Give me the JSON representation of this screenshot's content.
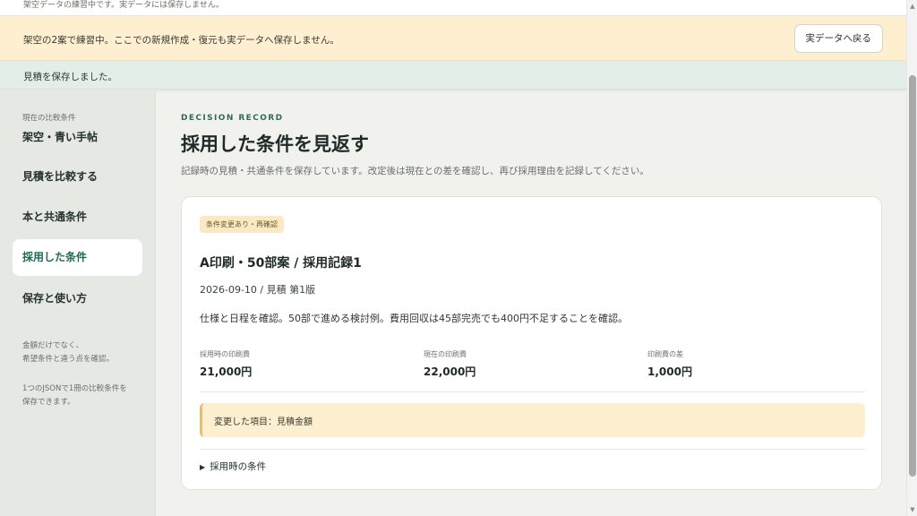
{
  "top_notice": "架空データの練習中です。実データには保存しません。",
  "practice_banner": {
    "message": "架空の2案で練習中。ここでの新規作成・復元も実データへ保存しません。",
    "back_button": "実データへ戻る"
  },
  "save_banner": "見積を保存しました。",
  "sidebar": {
    "comparison_label": "現在の比較条件",
    "comparison_name": "架空・青い手帖",
    "nav": [
      "見積を比較する",
      "本と共通条件",
      "採用した条件",
      "保存と使い方"
    ],
    "active_nav": "採用した条件",
    "note1": [
      "金額だけでなく、",
      "希望条件と違う点を確認。"
    ],
    "note2": [
      "1つのJSONで1冊の比較条件を",
      "保存できます。"
    ]
  },
  "main": {
    "eyebrow": "DECISION RECORD",
    "title": "採用した条件を見返す",
    "description": "記録時の見積・共通条件を保存しています。改定後は現在との差を確認し、再び採用理由を記録してください。",
    "card": {
      "badge": "条件変更あり・再確認",
      "title": "A印刷・50部案 / 採用記録1",
      "meta": "2026-09-10 / 見積 第1版",
      "note": "仕様と日程を確認。50部で進める検討例。費用回収は45部完売でも400円不足することを確認。",
      "metrics": [
        {
          "label": "採用時の印刷費",
          "value": "21,000円"
        },
        {
          "label": "現在の印刷費",
          "value": "22,000円"
        },
        {
          "label": "印刷費の差",
          "value": "1,000円"
        }
      ],
      "changed_items": "変更した項目：見積金額",
      "details_toggle": "採用時の条件"
    }
  },
  "colors": {
    "practice_banner_bg": "#fdefcf",
    "save_banner_bg": "#e3eee8",
    "sidebar_bg": "#e5e8e3",
    "accent_green": "#1d6a55",
    "badge_bg": "#fbe9c4"
  }
}
